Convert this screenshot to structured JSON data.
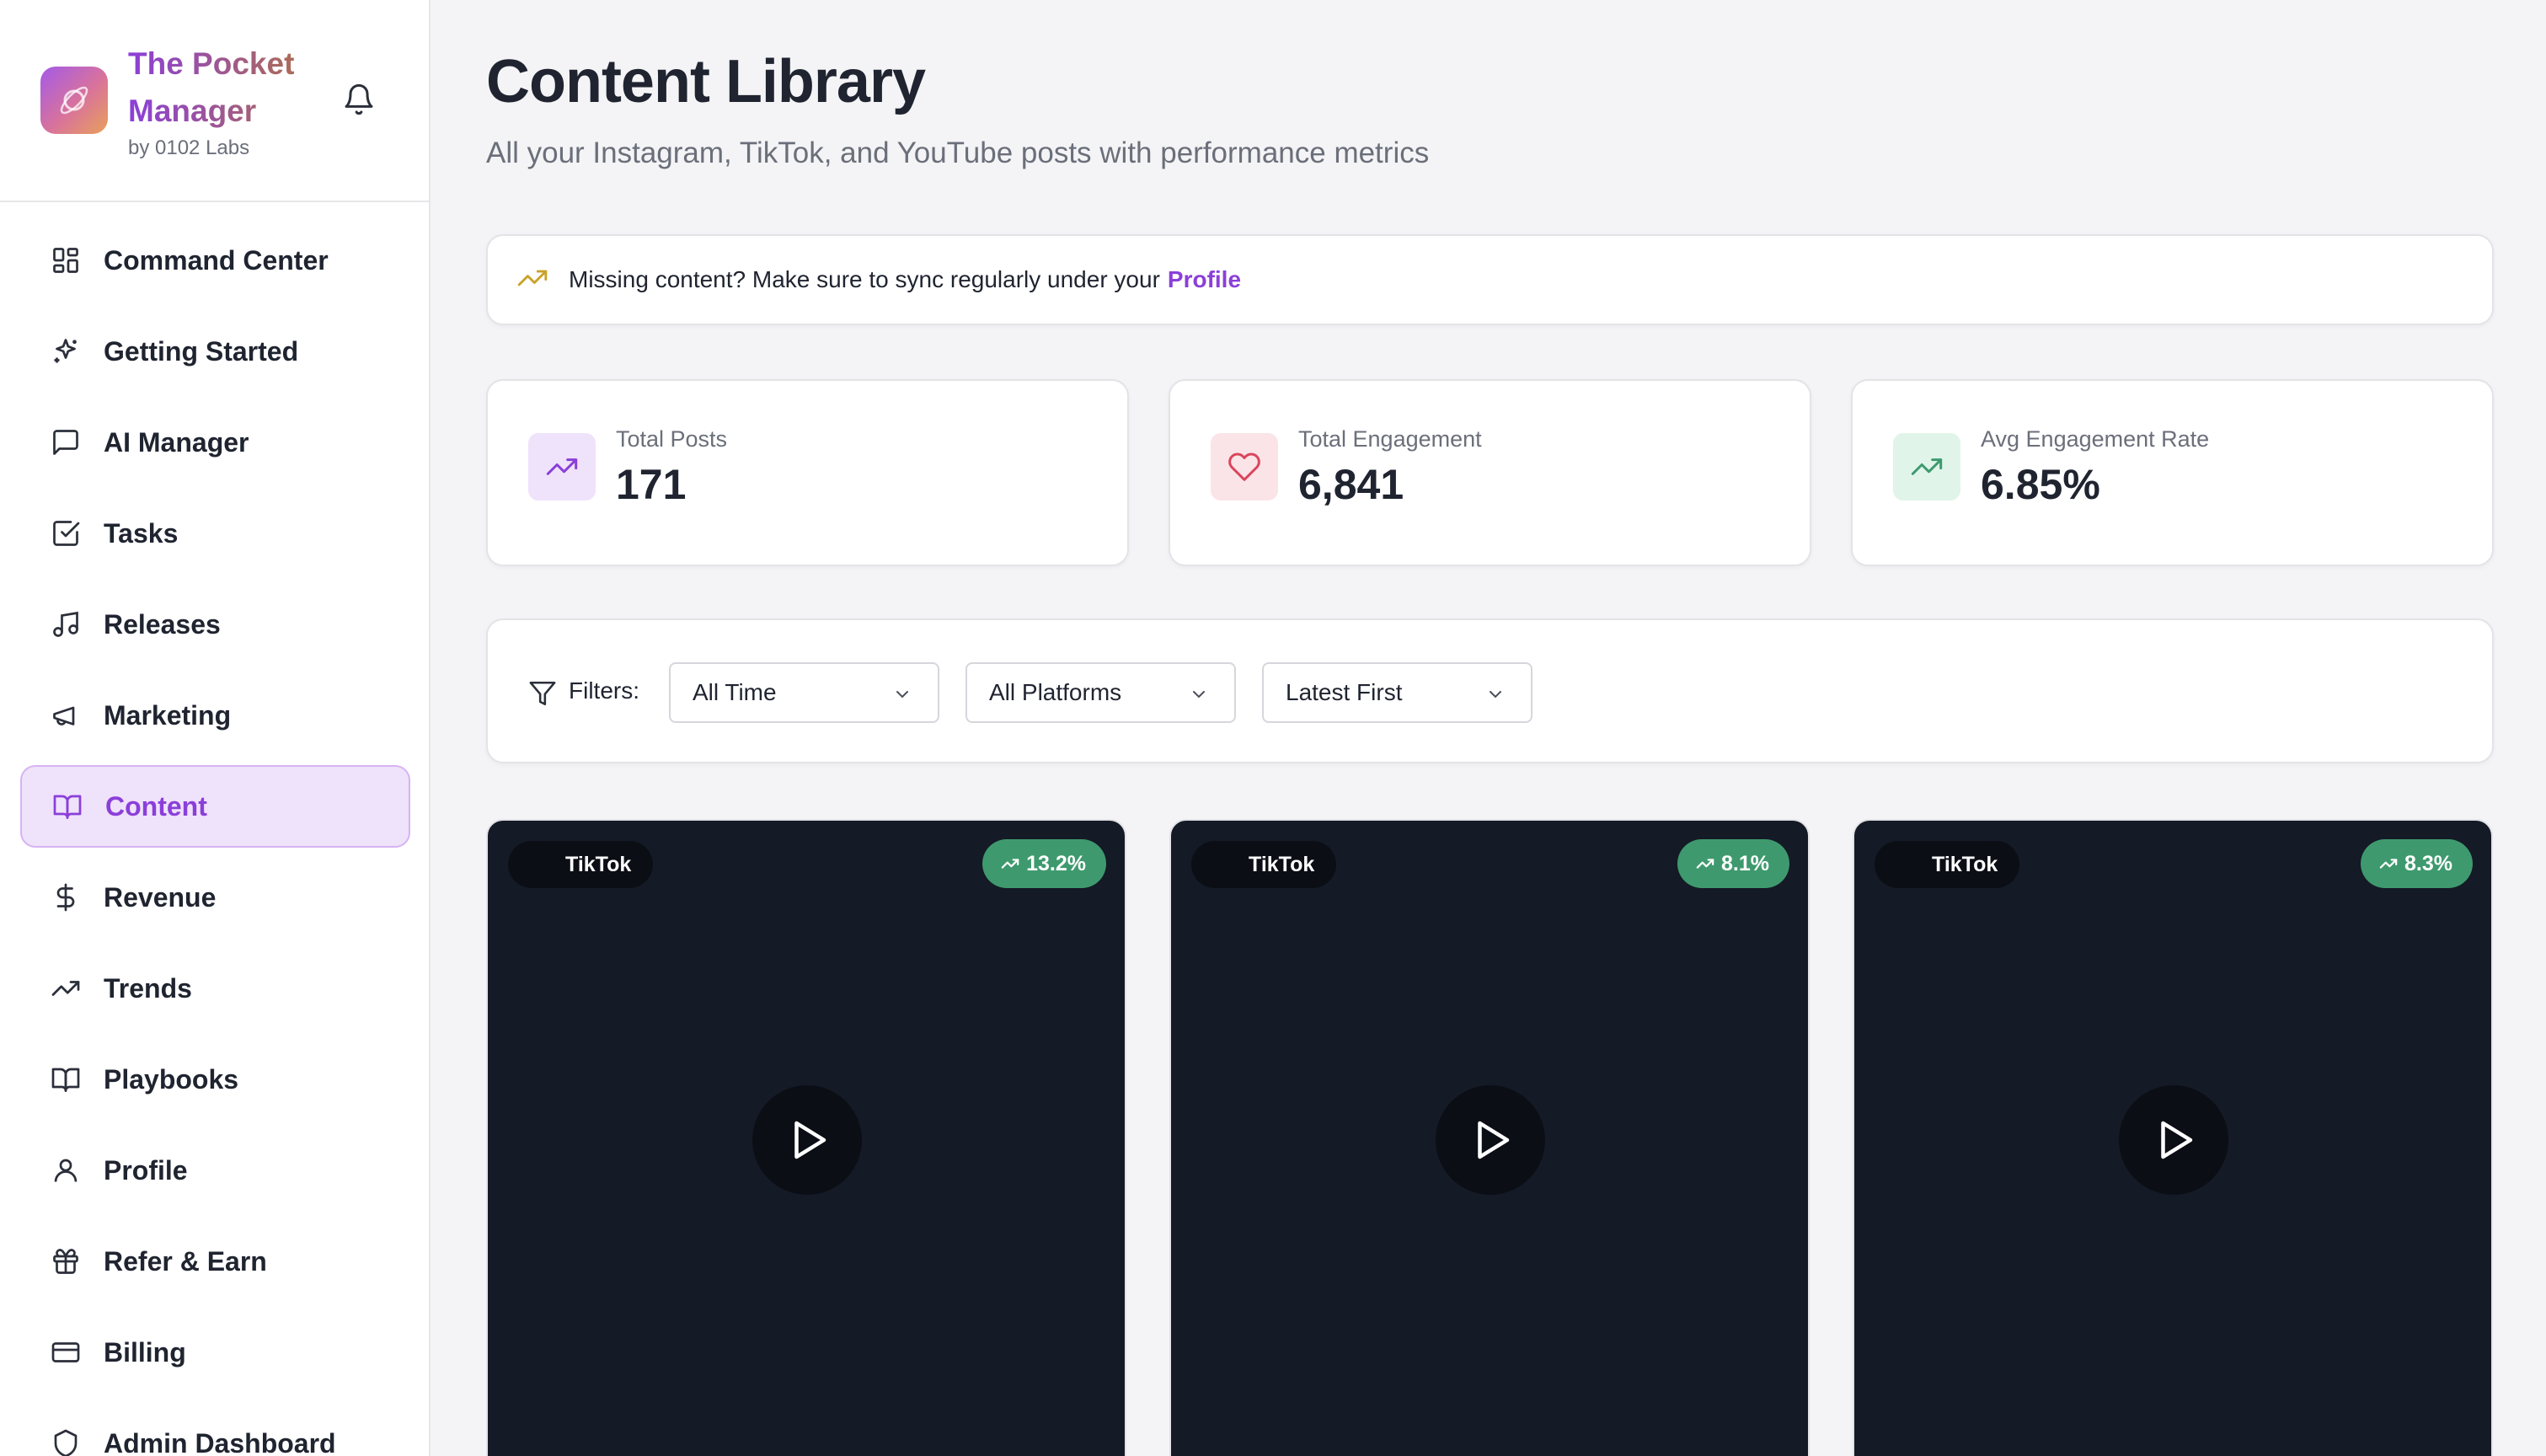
{
  "brand": {
    "name": "The Pocket Manager",
    "byline": "by 0102 Labs",
    "logo_icon": "planet-logo-icon"
  },
  "header": {
    "notifications_icon": "bell-icon"
  },
  "sidebar": {
    "items": [
      {
        "label": "Command Center",
        "icon": "grid-icon",
        "active": false
      },
      {
        "label": "Getting Started",
        "icon": "sparkles-icon",
        "active": false
      },
      {
        "label": "AI Manager",
        "icon": "chat-bubble-icon",
        "active": false
      },
      {
        "label": "Tasks",
        "icon": "checkbox-icon",
        "active": false
      },
      {
        "label": "Releases",
        "icon": "music-note-icon",
        "active": false
      },
      {
        "label": "Marketing",
        "icon": "megaphone-icon",
        "active": false
      },
      {
        "label": "Content",
        "icon": "book-open-icon",
        "active": true
      },
      {
        "label": "Revenue",
        "icon": "dollar-icon",
        "active": false
      },
      {
        "label": "Trends",
        "icon": "trending-up-icon",
        "active": false
      },
      {
        "label": "Playbooks",
        "icon": "book-open-icon",
        "active": false
      },
      {
        "label": "Profile",
        "icon": "user-icon",
        "active": false
      },
      {
        "label": "Refer & Earn",
        "icon": "gift-icon",
        "active": false
      },
      {
        "label": "Billing",
        "icon": "credit-card-icon",
        "active": false
      },
      {
        "label": "Admin Dashboard",
        "icon": "shield-icon",
        "active": false
      }
    ]
  },
  "main": {
    "title": "Content Library",
    "subtitle": "All your Instagram, TikTok, and YouTube posts with performance metrics",
    "notice": {
      "text": "Missing content? Make sure to sync regularly under your",
      "link": "Profile"
    },
    "stats": [
      {
        "label": "Total Posts",
        "value": "171",
        "icon": "trending-up-icon",
        "accent": "#8b3fd9",
        "bg": "#efe2fb"
      },
      {
        "label": "Total Engagement",
        "value": "6,841",
        "icon": "heart-icon",
        "accent": "#d9465c",
        "bg": "#fbe4e7"
      },
      {
        "label": "Avg Engagement Rate",
        "value": "6.85%",
        "icon": "trending-up-icon",
        "accent": "#3e9a6e",
        "bg": "#e1f4ea"
      }
    ],
    "filters": {
      "label": "Filters:",
      "time": "All Time",
      "platform": "All Platforms",
      "sort": "Latest First"
    },
    "posts": [
      {
        "platform": "TikTok",
        "rate": "13.2%"
      },
      {
        "platform": "TikTok",
        "rate": "8.1%"
      },
      {
        "platform": "TikTok",
        "rate": "8.3%"
      }
    ]
  },
  "colors": {
    "accent": "#8b3fd9",
    "success": "#3e9a6e",
    "card_dark": "#141a26"
  }
}
